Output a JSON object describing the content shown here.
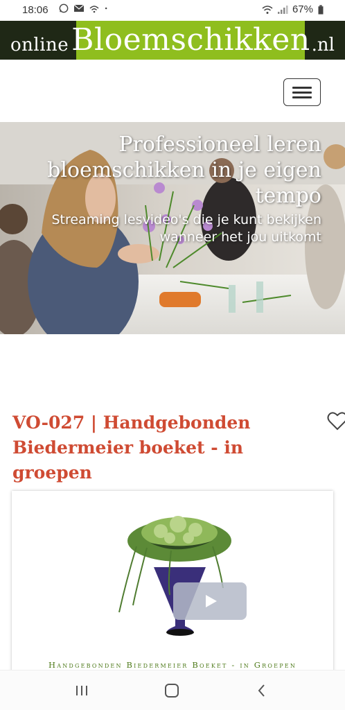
{
  "status_bar": {
    "time": "18:06",
    "battery": "67%",
    "icons_left": [
      "whatsapp-icon",
      "mail-icon",
      "wifi-calling-icon",
      "dot-icon"
    ],
    "icons_right": [
      "wifi-icon",
      "signal-icon",
      "battery-icon"
    ]
  },
  "header": {
    "logo_online": "online",
    "logo_main": "Bloemschikken",
    "logo_nl": ".nl",
    "colors": {
      "dark": "#1f2816",
      "green": "#8fbe1e"
    }
  },
  "nav": {
    "menu_icon": "hamburger-menu-icon"
  },
  "hero": {
    "title_lines": [
      "Professioneel leren",
      "bloemschikken in je eigen",
      "tempo"
    ],
    "subtitle_lines": [
      "Streaming lesvideo's die je kunt bekijken",
      "wanneer het jou uitkomt"
    ]
  },
  "product": {
    "title": "VO-027 | Handgebonden Biedermeier boeket - in groepen",
    "favorite_icon": "heart-outline-icon",
    "title_color": "#cf4b33"
  },
  "video": {
    "caption": "Handgebonden Biedermeier Boeket - in Groepen",
    "play_icon": "play-icon",
    "caption_color": "#4e7a1a"
  },
  "android_nav": {
    "recent": "recent-apps-icon",
    "home": "home-icon",
    "back": "back-icon"
  }
}
